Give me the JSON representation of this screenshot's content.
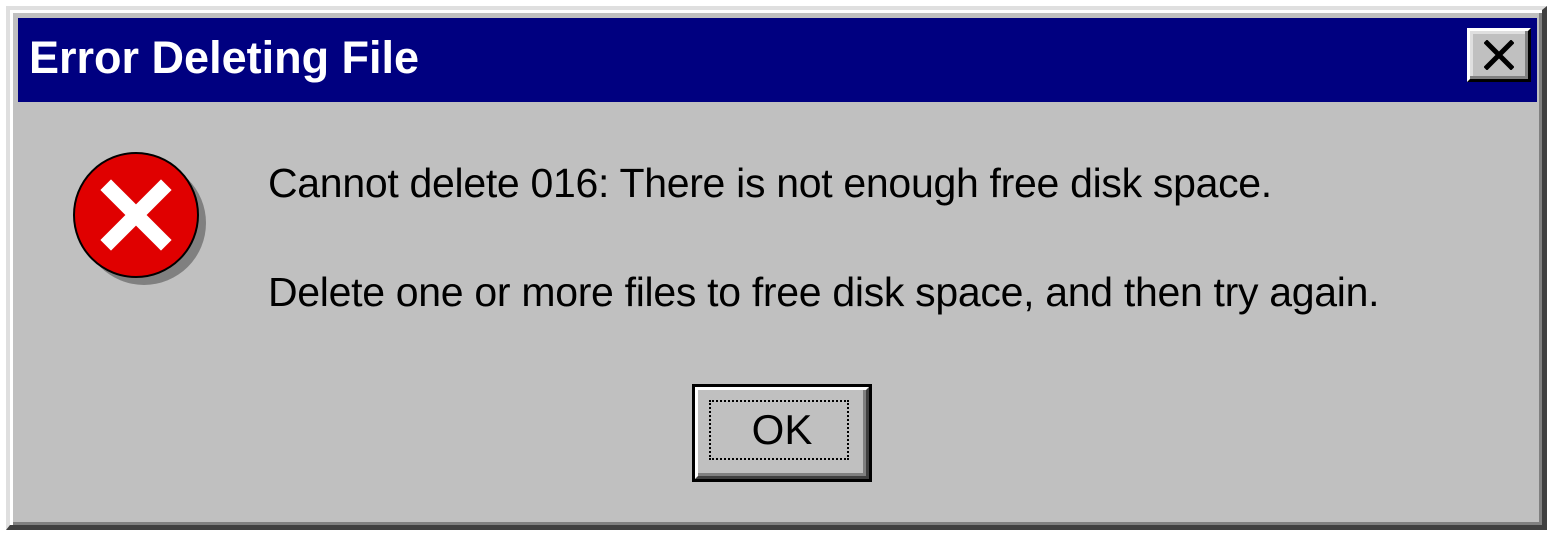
{
  "window": {
    "title": "Error Deleting File",
    "close_icon": "close-x-icon"
  },
  "dialog": {
    "icon": "error-icon",
    "message_line1": "Cannot delete 016: There is not enough free disk space.",
    "message_line2": "Delete one or more files to free disk space, and then try again.",
    "ok_label": "OK"
  },
  "colors": {
    "titlebar": "#000080",
    "face": "#c0c0c0",
    "error_red": "#e00000"
  }
}
